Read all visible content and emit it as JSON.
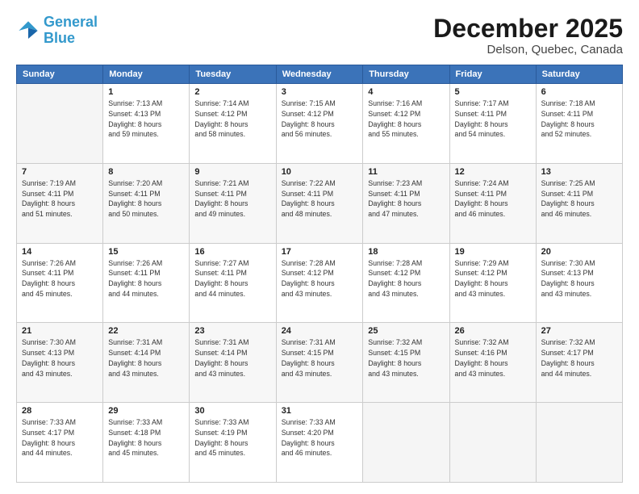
{
  "header": {
    "logo_line1": "General",
    "logo_line2": "Blue",
    "title": "December 2025",
    "subtitle": "Delson, Quebec, Canada"
  },
  "days_of_week": [
    "Sunday",
    "Monday",
    "Tuesday",
    "Wednesday",
    "Thursday",
    "Friday",
    "Saturday"
  ],
  "weeks": [
    [
      {
        "day": "",
        "info": ""
      },
      {
        "day": "1",
        "info": "Sunrise: 7:13 AM\nSunset: 4:13 PM\nDaylight: 8 hours\nand 59 minutes."
      },
      {
        "day": "2",
        "info": "Sunrise: 7:14 AM\nSunset: 4:12 PM\nDaylight: 8 hours\nand 58 minutes."
      },
      {
        "day": "3",
        "info": "Sunrise: 7:15 AM\nSunset: 4:12 PM\nDaylight: 8 hours\nand 56 minutes."
      },
      {
        "day": "4",
        "info": "Sunrise: 7:16 AM\nSunset: 4:12 PM\nDaylight: 8 hours\nand 55 minutes."
      },
      {
        "day": "5",
        "info": "Sunrise: 7:17 AM\nSunset: 4:11 PM\nDaylight: 8 hours\nand 54 minutes."
      },
      {
        "day": "6",
        "info": "Sunrise: 7:18 AM\nSunset: 4:11 PM\nDaylight: 8 hours\nand 52 minutes."
      }
    ],
    [
      {
        "day": "7",
        "info": "Sunrise: 7:19 AM\nSunset: 4:11 PM\nDaylight: 8 hours\nand 51 minutes."
      },
      {
        "day": "8",
        "info": "Sunrise: 7:20 AM\nSunset: 4:11 PM\nDaylight: 8 hours\nand 50 minutes."
      },
      {
        "day": "9",
        "info": "Sunrise: 7:21 AM\nSunset: 4:11 PM\nDaylight: 8 hours\nand 49 minutes."
      },
      {
        "day": "10",
        "info": "Sunrise: 7:22 AM\nSunset: 4:11 PM\nDaylight: 8 hours\nand 48 minutes."
      },
      {
        "day": "11",
        "info": "Sunrise: 7:23 AM\nSunset: 4:11 PM\nDaylight: 8 hours\nand 47 minutes."
      },
      {
        "day": "12",
        "info": "Sunrise: 7:24 AM\nSunset: 4:11 PM\nDaylight: 8 hours\nand 46 minutes."
      },
      {
        "day": "13",
        "info": "Sunrise: 7:25 AM\nSunset: 4:11 PM\nDaylight: 8 hours\nand 46 minutes."
      }
    ],
    [
      {
        "day": "14",
        "info": "Sunrise: 7:26 AM\nSunset: 4:11 PM\nDaylight: 8 hours\nand 45 minutes."
      },
      {
        "day": "15",
        "info": "Sunrise: 7:26 AM\nSunset: 4:11 PM\nDaylight: 8 hours\nand 44 minutes."
      },
      {
        "day": "16",
        "info": "Sunrise: 7:27 AM\nSunset: 4:11 PM\nDaylight: 8 hours\nand 44 minutes."
      },
      {
        "day": "17",
        "info": "Sunrise: 7:28 AM\nSunset: 4:12 PM\nDaylight: 8 hours\nand 43 minutes."
      },
      {
        "day": "18",
        "info": "Sunrise: 7:28 AM\nSunset: 4:12 PM\nDaylight: 8 hours\nand 43 minutes."
      },
      {
        "day": "19",
        "info": "Sunrise: 7:29 AM\nSunset: 4:12 PM\nDaylight: 8 hours\nand 43 minutes."
      },
      {
        "day": "20",
        "info": "Sunrise: 7:30 AM\nSunset: 4:13 PM\nDaylight: 8 hours\nand 43 minutes."
      }
    ],
    [
      {
        "day": "21",
        "info": "Sunrise: 7:30 AM\nSunset: 4:13 PM\nDaylight: 8 hours\nand 43 minutes."
      },
      {
        "day": "22",
        "info": "Sunrise: 7:31 AM\nSunset: 4:14 PM\nDaylight: 8 hours\nand 43 minutes."
      },
      {
        "day": "23",
        "info": "Sunrise: 7:31 AM\nSunset: 4:14 PM\nDaylight: 8 hours\nand 43 minutes."
      },
      {
        "day": "24",
        "info": "Sunrise: 7:31 AM\nSunset: 4:15 PM\nDaylight: 8 hours\nand 43 minutes."
      },
      {
        "day": "25",
        "info": "Sunrise: 7:32 AM\nSunset: 4:15 PM\nDaylight: 8 hours\nand 43 minutes."
      },
      {
        "day": "26",
        "info": "Sunrise: 7:32 AM\nSunset: 4:16 PM\nDaylight: 8 hours\nand 43 minutes."
      },
      {
        "day": "27",
        "info": "Sunrise: 7:32 AM\nSunset: 4:17 PM\nDaylight: 8 hours\nand 44 minutes."
      }
    ],
    [
      {
        "day": "28",
        "info": "Sunrise: 7:33 AM\nSunset: 4:17 PM\nDaylight: 8 hours\nand 44 minutes."
      },
      {
        "day": "29",
        "info": "Sunrise: 7:33 AM\nSunset: 4:18 PM\nDaylight: 8 hours\nand 45 minutes."
      },
      {
        "day": "30",
        "info": "Sunrise: 7:33 AM\nSunset: 4:19 PM\nDaylight: 8 hours\nand 45 minutes."
      },
      {
        "day": "31",
        "info": "Sunrise: 7:33 AM\nSunset: 4:20 PM\nDaylight: 8 hours\nand 46 minutes."
      },
      {
        "day": "",
        "info": ""
      },
      {
        "day": "",
        "info": ""
      },
      {
        "day": "",
        "info": ""
      }
    ]
  ]
}
